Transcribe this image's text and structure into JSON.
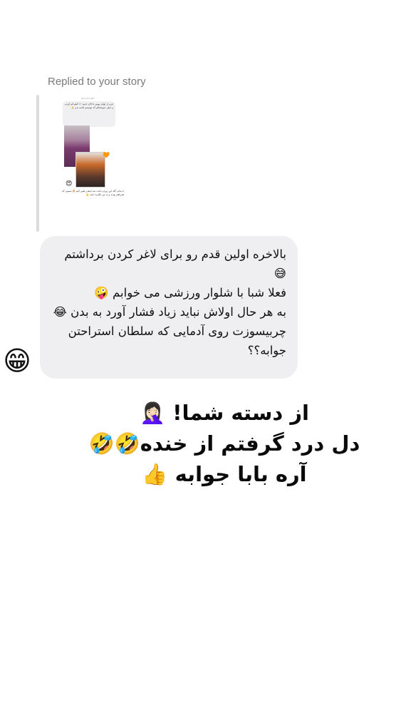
{
  "reply_header": "Replied to your story",
  "story_preview": {
    "header": "Sat 4:15 PM",
    "bubble_text": "عزم از اوایل بهمن تا الان حدود ۱۱ کیلو کم کردم و خیلی خوشحالم که تونستم ادامه بدم 🙏",
    "emoji": "😍",
    "side_emoji": "🧡",
    "caption": "با شاپ گلد این روزام باعث شد اینقدر تغییر کنم 🔥 ممنون که همراهم بودید و به من انگیزه دادید 💪"
  },
  "message": {
    "lines": [
      "بالاخره اولین قدم رو برای لاغر کردن برداشتم 😅",
      "فعلا شبا با شلوار ورزشی می خوابم 🤪",
      "به هر حال اولاش نباید زیاد فشار آورد به بدن 😂",
      "چربیسوزت روی آدمایی که سلطان استراحتن جوابه؟؟"
    ]
  },
  "sender_avatar": "😁",
  "overlay_text": {
    "line1": "از دسته شما! 🤦🏻‍♀️",
    "line2": "دل درد گرفتم از خنده🤣🤣",
    "line3": "آره بابا جوابه 👍"
  }
}
